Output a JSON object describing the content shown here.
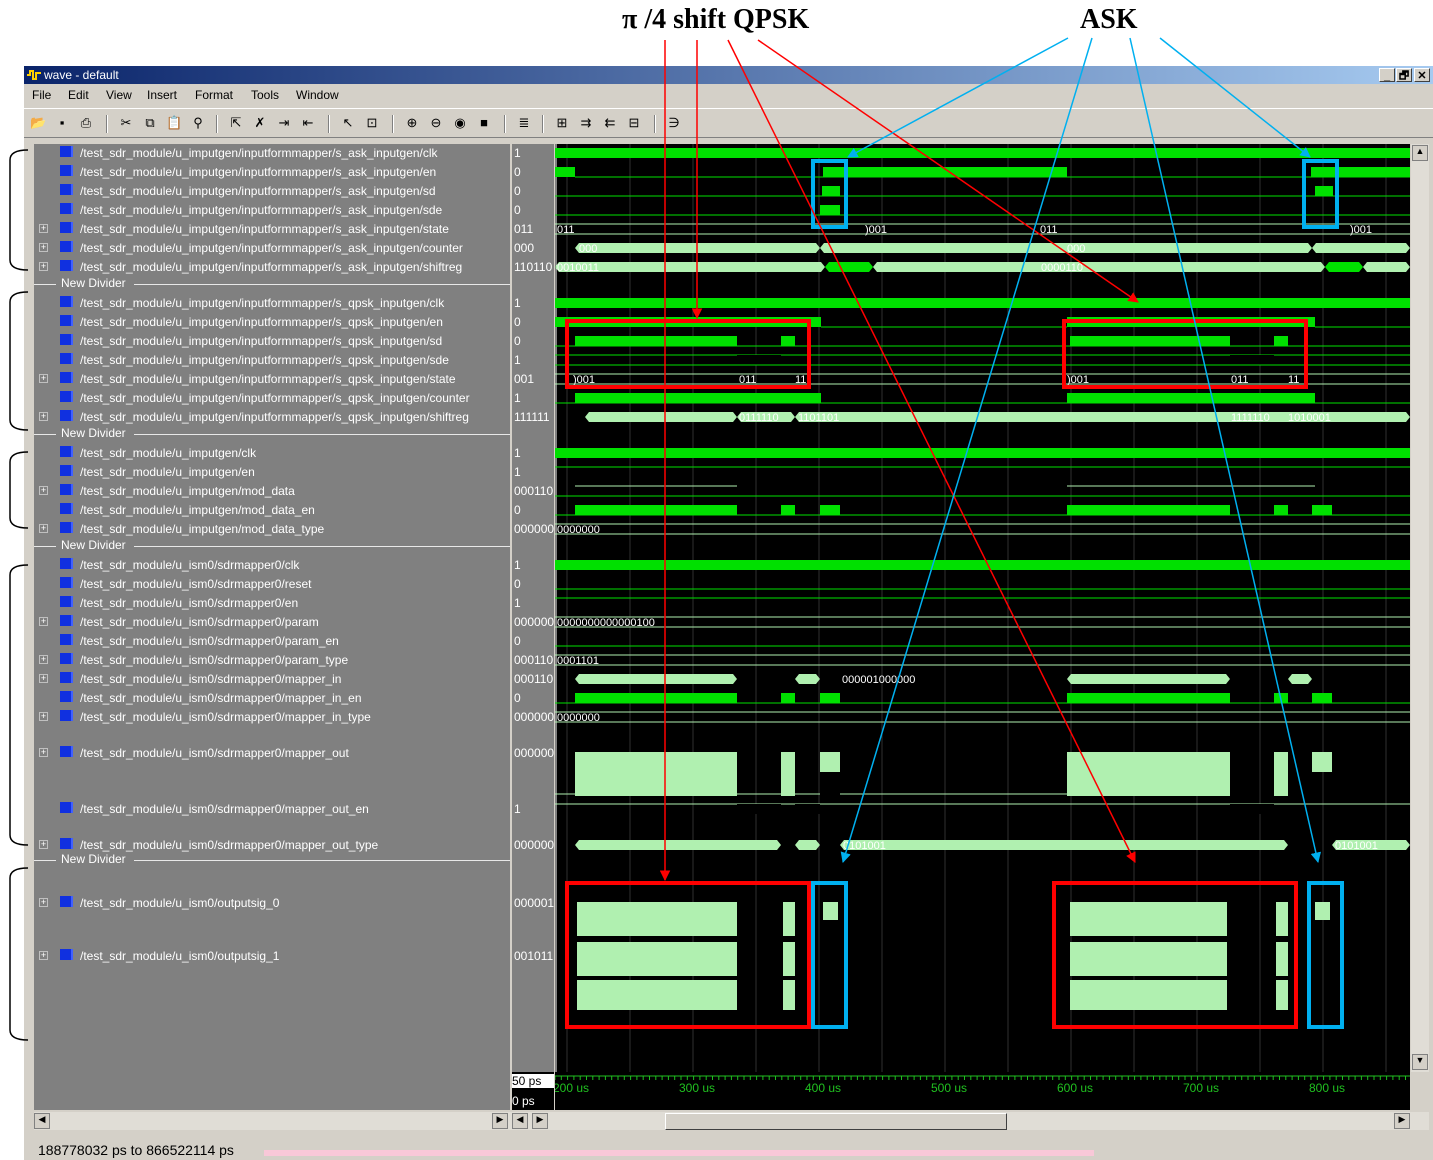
{
  "annotations": {
    "qpsk_label": "π /4 shift QPSK",
    "ask_label": "ASK"
  },
  "window": {
    "title": "wave - default",
    "title_buttons": [
      "_",
      "🗗",
      "✕"
    ]
  },
  "menu": [
    "File",
    "Edit",
    "View",
    "Insert",
    "Format",
    "Tools",
    "Window"
  ],
  "toolbar_icons": [
    "open-icon",
    "save-icon",
    "print-icon",
    "cut-icon",
    "copy-icon",
    "paste-icon",
    "find-icon",
    "select-icon",
    "delete-icon",
    "indent-icon",
    "outdent-icon",
    "pointer-icon",
    "zoom-area-icon",
    "zoom-in-icon",
    "zoom-out-icon",
    "zoom-full-icon",
    "stop-icon",
    "wave-icon",
    "step-icon",
    "next-edge-icon",
    "prev-edge-icon",
    "add-cursor-icon",
    "delete-cursor-icon"
  ],
  "signals": [
    {
      "name": "/test_sdr_module/u_imputgen/inputformmapper/s_ask_inputgen/clk",
      "value": "1",
      "expandable": false
    },
    {
      "name": "/test_sdr_module/u_imputgen/inputformmapper/s_ask_inputgen/en",
      "value": "0",
      "expandable": false
    },
    {
      "name": "/test_sdr_module/u_imputgen/inputformmapper/s_ask_inputgen/sd",
      "value": "0",
      "expandable": false
    },
    {
      "name": "/test_sdr_module/u_imputgen/inputformmapper/s_ask_inputgen/sde",
      "value": "0",
      "expandable": false
    },
    {
      "name": "/test_sdr_module/u_imputgen/inputformmapper/s_ask_inputgen/state",
      "value": "011",
      "expandable": true
    },
    {
      "name": "/test_sdr_module/u_imputgen/inputformmapper/s_ask_inputgen/counter",
      "value": "000",
      "expandable": true
    },
    {
      "name": "/test_sdr_module/u_imputgen/inputformmapper/s_ask_inputgen/shiftreg",
      "value": "110110",
      "expandable": true
    },
    {
      "divider": "New Divider"
    },
    {
      "name": "/test_sdr_module/u_imputgen/inputformmapper/s_qpsk_inputgen/clk",
      "value": "1",
      "expandable": false
    },
    {
      "name": "/test_sdr_module/u_imputgen/inputformmapper/s_qpsk_inputgen/en",
      "value": "0",
      "expandable": false
    },
    {
      "name": "/test_sdr_module/u_imputgen/inputformmapper/s_qpsk_inputgen/sd",
      "value": "0",
      "expandable": false
    },
    {
      "name": "/test_sdr_module/u_imputgen/inputformmapper/s_qpsk_inputgen/sde",
      "value": "1",
      "expandable": false
    },
    {
      "name": "/test_sdr_module/u_imputgen/inputformmapper/s_qpsk_inputgen/state",
      "value": "001",
      "expandable": true
    },
    {
      "name": "/test_sdr_module/u_imputgen/inputformmapper/s_qpsk_inputgen/counter",
      "value": "1",
      "expandable": false
    },
    {
      "name": "/test_sdr_module/u_imputgen/inputformmapper/s_qpsk_inputgen/shiftreg",
      "value": "111111",
      "expandable": true
    },
    {
      "divider": "New Divider"
    },
    {
      "name": "/test_sdr_module/u_imputgen/clk",
      "value": "1",
      "expandable": false
    },
    {
      "name": "/test_sdr_module/u_imputgen/en",
      "value": "1",
      "expandable": false
    },
    {
      "name": "/test_sdr_module/u_imputgen/mod_data",
      "value": "000110",
      "expandable": true
    },
    {
      "name": "/test_sdr_module/u_imputgen/mod_data_en",
      "value": "0",
      "expandable": false
    },
    {
      "name": "/test_sdr_module/u_imputgen/mod_data_type",
      "value": "000000",
      "expandable": true
    },
    {
      "divider": "New Divider"
    },
    {
      "name": "/test_sdr_module/u_ism0/sdrmapper0/clk",
      "value": "1",
      "expandable": false
    },
    {
      "name": "/test_sdr_module/u_ism0/sdrmapper0/reset",
      "value": "0",
      "expandable": false
    },
    {
      "name": "/test_sdr_module/u_ism0/sdrmapper0/en",
      "value": "1",
      "expandable": false
    },
    {
      "name": "/test_sdr_module/u_ism0/sdrmapper0/param",
      "value": "000000",
      "expandable": true
    },
    {
      "name": "/test_sdr_module/u_ism0/sdrmapper0/param_en",
      "value": "0",
      "expandable": false
    },
    {
      "name": "/test_sdr_module/u_ism0/sdrmapper0/param_type",
      "value": "000110",
      "expandable": true
    },
    {
      "name": "/test_sdr_module/u_ism0/sdrmapper0/mapper_in",
      "value": "000110",
      "expandable": true
    },
    {
      "name": "/test_sdr_module/u_ism0/sdrmapper0/mapper_in_en",
      "value": "0",
      "expandable": false
    },
    {
      "name": "/test_sdr_module/u_ism0/sdrmapper0/mapper_in_type",
      "value": "000000",
      "expandable": true
    },
    {
      "name": "/test_sdr_module/u_ism0/sdrmapper0/mapper_out",
      "value": "000000",
      "expandable": true
    },
    {
      "name": "/test_sdr_module/u_ism0/sdrmapper0/mapper_out_en",
      "value": "1",
      "expandable": false
    },
    {
      "name": "/test_sdr_module/u_ism0/sdrmapper0/mapper_out_type",
      "value": "000000",
      "expandable": true
    },
    {
      "divider": "New Divider"
    },
    {
      "name": "/test_sdr_module/u_ism0/outputsig_0",
      "value": "000001",
      "expandable": true
    },
    {
      "name": "/test_sdr_module/u_ism0/outputsig_1",
      "value": "001011",
      "expandable": true
    }
  ],
  "bus_labels": {
    "ask_state": [
      "011",
      ")001",
      "011",
      ")001"
    ],
    "ask_counter": [
      "000",
      "000"
    ],
    "ask_shiftreg": [
      "0010011",
      "0000110"
    ],
    "qpsk_state": [
      ")001",
      "011",
      "11",
      ")001",
      "011",
      "11"
    ],
    "qpsk_shiftreg": [
      "0111110",
      "1101101",
      "1111110",
      "1010001"
    ],
    "mod_data_type": "0000000",
    "param": "0000000000000100",
    "param_type": "0001101",
    "mapper_in": "000001000000",
    "mapper_in_type": "0000000",
    "mapper_out_type": [
      "0101001",
      "0101001"
    ]
  },
  "cursor": {
    "now": "50 ps",
    "cursor1": "0 ps"
  },
  "time_axis": [
    "200 us",
    "300 us",
    "400 us",
    "500 us",
    "600 us",
    "700 us",
    "800 us"
  ],
  "status": "188778032 ps to 866522114 ps",
  "colors": {
    "wave_bright": "#00e000",
    "wave_light": "#b0f0b0",
    "annotation_red": "#ff0000",
    "annotation_blue": "#00b0f0",
    "time_axis": "#20c020"
  }
}
